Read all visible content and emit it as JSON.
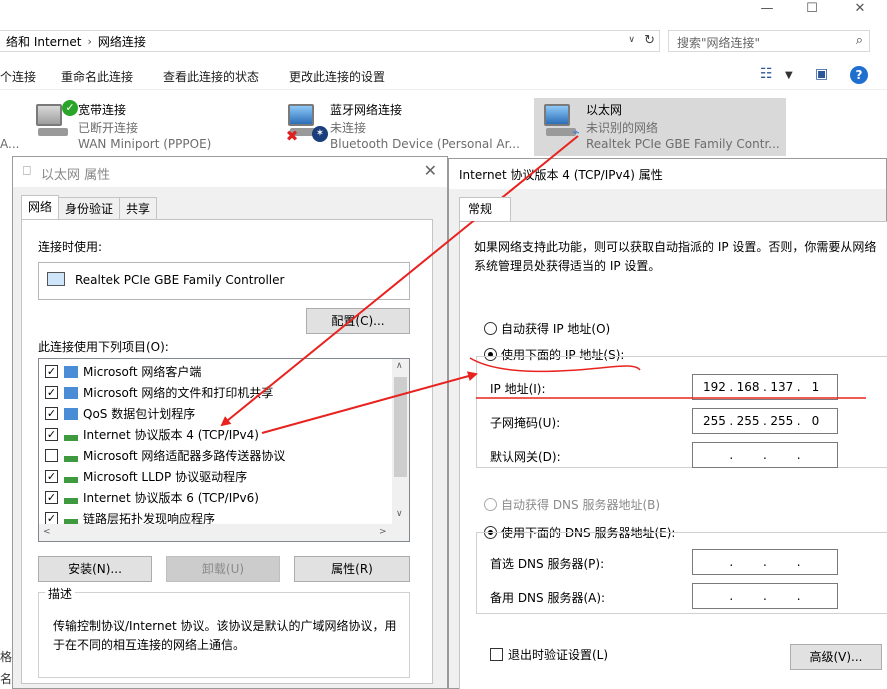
{
  "explorer": {
    "breadcrumb": [
      "络和 Internet",
      "网络连接"
    ],
    "search_placeholder": "搜索\"网络连接\"",
    "commands": [
      "个连接",
      "重命名此连接",
      "查看此连接的状态",
      "更改此连接的设置"
    ],
    "connections": [
      {
        "name": "宽带连接",
        "status": "已断开连接",
        "device": "WAN Miniport (PPPOE)"
      },
      {
        "name": "蓝牙网络连接",
        "status": "未连接",
        "device": "Bluetooth Device (Personal Ar..."
      },
      {
        "name": "以太网",
        "status": "未识别的网络",
        "device": "Realtek PCIe GBE Family Contr..."
      }
    ],
    "left_clip": [
      "A...",
      "格",
      "名"
    ]
  },
  "eth_dialog": {
    "title": "以太网 属性",
    "tabs": [
      "网络",
      "身份验证",
      "共享"
    ],
    "connect_using_label": "连接时使用:",
    "adapter_name": "Realtek PCIe GBE Family Controller",
    "configure_button": "配置(C)...",
    "items_label": "此连接使用下列项目(O):",
    "items": [
      {
        "label": "Microsoft 网络客户端",
        "checked": true
      },
      {
        "label": "Microsoft 网络的文件和打印机共享",
        "checked": true
      },
      {
        "label": "QoS 数据包计划程序",
        "checked": true
      },
      {
        "label": "Internet 协议版本 4 (TCP/IPv4)",
        "checked": true
      },
      {
        "label": "Microsoft 网络适配器多路传送器协议",
        "checked": false
      },
      {
        "label": "Microsoft LLDP 协议驱动程序",
        "checked": true
      },
      {
        "label": "Internet 协议版本 6 (TCP/IPv6)",
        "checked": true
      },
      {
        "label": "链路层拓扑发现响应程序",
        "checked": true
      }
    ],
    "install_button": "安装(N)...",
    "uninstall_button": "卸载(U)",
    "properties_button": "属性(R)",
    "description_legend": "描述",
    "description_text": "传输控制协议/Internet 协议。该协议是默认的广域网络协议，用于在不同的相互连接的网络上通信。"
  },
  "ipv4_dialog": {
    "title": "Internet 协议版本 4 (TCP/IPv4) 属性",
    "tab": "常规",
    "intro": "如果网络支持此功能，则可以获取自动指派的 IP 设置。否则，你需要从网络系统管理员处获得适当的 IP 设置。",
    "auto_ip": "自动获得 IP 地址(O)",
    "manual_ip": "使用下面的 IP 地址(S):",
    "ip_label": "IP 地址(I):",
    "ip_value": [
      "192",
      "168",
      "137",
      "1"
    ],
    "mask_label": "子网掩码(U):",
    "mask_value": [
      "255",
      "255",
      "255",
      "0"
    ],
    "gateway_label": "默认网关(D):",
    "auto_dns": "自动获得 DNS 服务器地址(B)",
    "manual_dns": "使用下面的 DNS 服务器地址(E):",
    "pref_dns_label": "首选 DNS 服务器(P):",
    "alt_dns_label": "备用 DNS 服务器(A):",
    "validate_on_exit": "退出时验证设置(L)",
    "advanced_button": "高级(V)..."
  },
  "colors": {
    "annotation_red": "#e8231f",
    "help_blue": "#1f6fd1"
  }
}
